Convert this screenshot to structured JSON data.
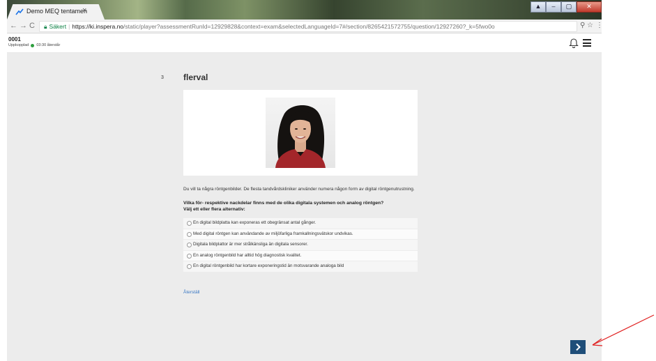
{
  "browser": {
    "tab_title": "Demo MEQ tentamen",
    "tab_close": "×",
    "secure_label": "Säkert",
    "url_host": "https://ki.inspera.no",
    "url_rest": "/static/player?assessmentRunId=12929828&context=exam&selectedLanguageId=7#/section/8265421572755/question/12927260?_k=5fwo0o",
    "window_buttons": [
      "▲",
      "–",
      "▢",
      "✕"
    ]
  },
  "header": {
    "code": "0001",
    "status_text": "Uppkopplad",
    "time_remaining": "03:30 återstår",
    "status_color": "#2e9e3e"
  },
  "question": {
    "number": "3",
    "title": "flerval",
    "intro": "Du vill ta några röntgenbilder. De flesta tandvårdskliniker använder numera någon form av digital röntgenutrustning.",
    "prompt_line1": "Vilka för- respektive nackdelar finns med de olika digitala systemen och analog röntgen?",
    "prompt_line2": "Välj ett eller flera alternativ:",
    "options": [
      {
        "label": "En digital bildplatta kan exponeras ett obegränsat antal gånger."
      },
      {
        "label": "Med digital röntgen kan användande av miljöfarliga framkallningsvätskor undvikas."
      },
      {
        "label": "Digitala bildplattor är mer strålkänsliga än digitala sensorer."
      },
      {
        "label": "En analog röntgenbild har alltid hög diagnostisk kvalitet."
      },
      {
        "label": "En digital röntgenbild har kortare exponeringstid än motsvarande analoga bild"
      }
    ],
    "reset_label": "Återställ"
  },
  "navigation": {
    "next_icon": "chevron-right",
    "accent_color": "#1f4e79",
    "annotation_arrow_color": "#e02020"
  }
}
